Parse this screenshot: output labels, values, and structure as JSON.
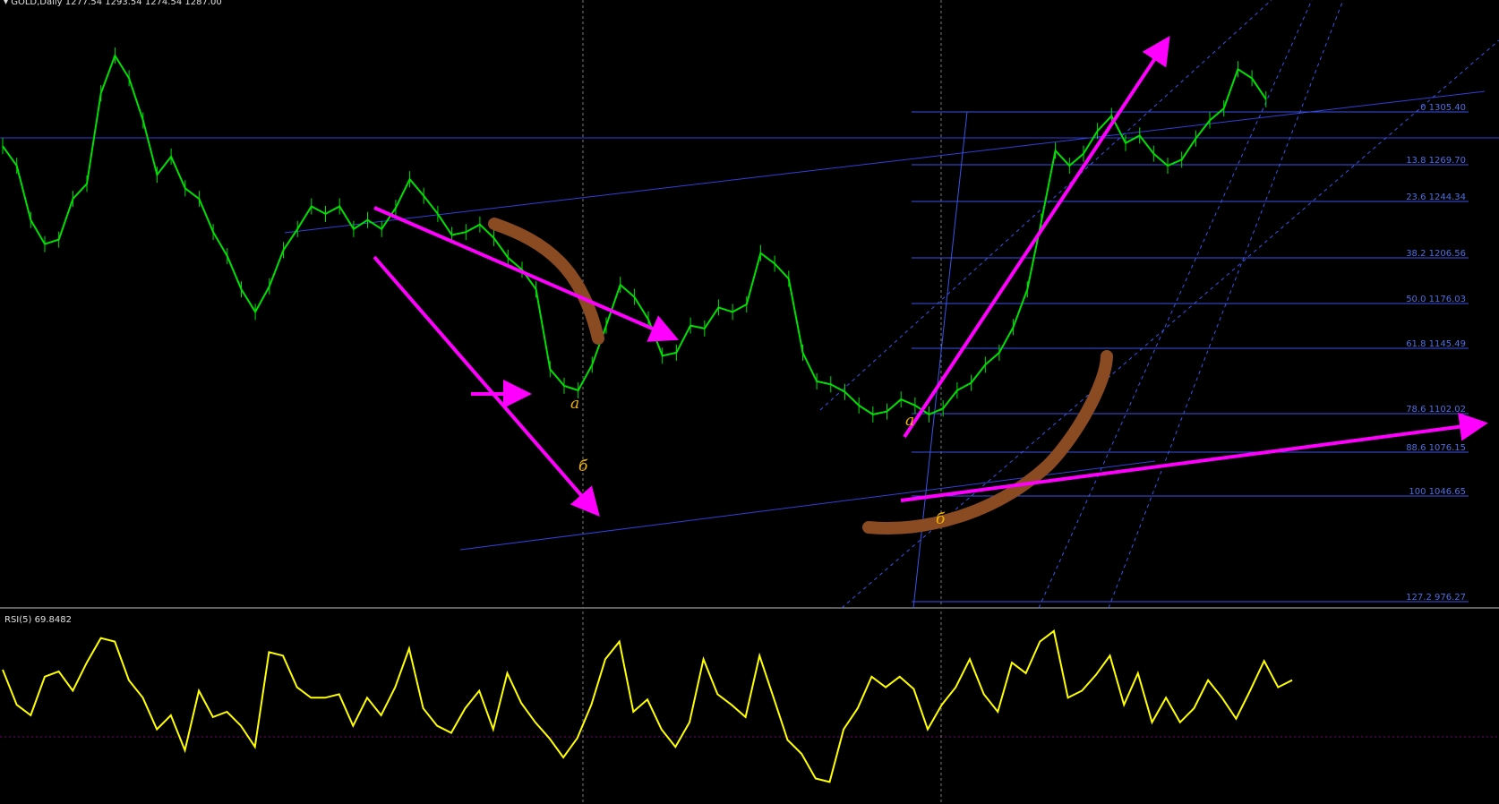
{
  "window": {
    "title": "GOLD,Daily",
    "ohlc": "1277.54 1293.54 1274.54 1287.00"
  },
  "colors": {
    "background": "#000000",
    "bull_candle": "#00e000",
    "bear_candle": "#00e000",
    "trendline": "#3040d8",
    "fibo": "#3a55e6",
    "fibo_text": "#4f6fe0",
    "arrow": "#ff00ff",
    "brush": "#8a4a22",
    "rsi": "#ffff00",
    "rsi_level": "#800080",
    "crosshair": "#7a7a7a",
    "separator": "#c0c0c0"
  },
  "fibonacci": [
    {
      "level": "0",
      "price": "1305.40"
    },
    {
      "level": "13.8",
      "price": "1269.70"
    },
    {
      "level": "23.6",
      "price": "1244.34"
    },
    {
      "level": "38.2",
      "price": "1206.56"
    },
    {
      "level": "50.0",
      "price": "1176.03"
    },
    {
      "level": "61.8",
      "price": "1145.49"
    },
    {
      "level": "78.6",
      "price": "1102.02"
    },
    {
      "level": "88.6",
      "price": "1076.15"
    },
    {
      "level": "100",
      "price": "1046.65"
    },
    {
      "level": "127.2",
      "price": "976.27"
    }
  ],
  "wave_labels": {
    "first_a": "a",
    "first_b": "б",
    "second_a": "a",
    "second_b": "б"
  },
  "rsi": {
    "label": "RSI(5) 69.8482",
    "period": 5,
    "value": 69.8482,
    "levels": [
      30,
      70
    ]
  },
  "chart_data": {
    "type": "line",
    "title": "GOLD,Daily",
    "subtitle": "1277.54 1293.54 1274.54 1287.00",
    "ylim": [
      950,
      1330
    ],
    "x": [
      0,
      15,
      30,
      45,
      60,
      75,
      90,
      105,
      120,
      135,
      150,
      165,
      180,
      195,
      210,
      225,
      240,
      255,
      270,
      285,
      300,
      315,
      330,
      345,
      360,
      375,
      390,
      405,
      420,
      435,
      450,
      465,
      480,
      495,
      510,
      525,
      540,
      555,
      570,
      585,
      600,
      615,
      630,
      645,
      660,
      675,
      690,
      705,
      720,
      735,
      750,
      765,
      780,
      795,
      810,
      825,
      840,
      855,
      870,
      885,
      900,
      915,
      930,
      945,
      960,
      975,
      990,
      1005,
      1020,
      1035,
      1050,
      1065,
      1080,
      1095,
      1110,
      1125,
      1140,
      1155,
      1170,
      1185,
      1200,
      1215,
      1230,
      1245,
      1260,
      1275,
      1290,
      1305,
      1320,
      1335,
      1350
    ],
    "series": [
      {
        "name": "GOLD,Daily",
        "values": [
          1245,
          1232,
          1196,
          1180,
          1183,
          1210,
          1220,
          1280,
          1305,
          1290,
          1262,
          1226,
          1238,
          1217,
          1210,
          1188,
          1172,
          1150,
          1135,
          1152,
          1176,
          1190,
          1205,
          1200,
          1205,
          1190,
          1196,
          1190,
          1204,
          1223,
          1212,
          1200,
          1186,
          1188,
          1193,
          1184,
          1171,
          1163,
          1150,
          1097,
          1086,
          1083,
          1100,
          1126,
          1153,
          1145,
          1130,
          1106,
          1108,
          1126,
          1124,
          1138,
          1135,
          1140,
          1174,
          1167,
          1157,
          1108,
          1089,
          1087,
          1082,
          1073,
          1067,
          1069,
          1077,
          1073,
          1067,
          1071,
          1083,
          1088,
          1100,
          1108,
          1125,
          1150,
          1195,
          1242,
          1232,
          1240,
          1255,
          1265,
          1247,
          1252,
          1240,
          1232,
          1236,
          1250,
          1262,
          1270,
          1296,
          1290,
          1276
        ]
      }
    ],
    "annotations": [
      "0 1305.40",
      "13.8 1269.70",
      "23.6 1244.34",
      "38.2 1206.56",
      "50.0 1176.03",
      "61.8 1145.49",
      "78.6 1102.02",
      "88.6 1076.15",
      "100 1046.65",
      "127.2 976.27"
    ]
  },
  "rsi_chart_data": {
    "type": "line",
    "ylim": [
      0,
      100
    ],
    "series": [
      {
        "name": "RSI(5)",
        "values": [
          74,
          54,
          48,
          70,
          73,
          62,
          78,
          92,
          90,
          68,
          58,
          40,
          48,
          28,
          62,
          47,
          50,
          42,
          30,
          84,
          82,
          64,
          58,
          58,
          60,
          42,
          58,
          48,
          64,
          86,
          52,
          42,
          38,
          52,
          62,
          40,
          72,
          55,
          44,
          35,
          24,
          35,
          54,
          80,
          90,
          50,
          57,
          40,
          30,
          44,
          80,
          60,
          54,
          47,
          82,
          58,
          34,
          26,
          12,
          10,
          40,
          52,
          70,
          64,
          70,
          63,
          40,
          54,
          64,
          80,
          60,
          50,
          78,
          72,
          90,
          96,
          58,
          62,
          71,
          82,
          54,
          72,
          44,
          58,
          44,
          52,
          68,
          58,
          46,
          62,
          79,
          64,
          68
        ]
      }
    ]
  }
}
